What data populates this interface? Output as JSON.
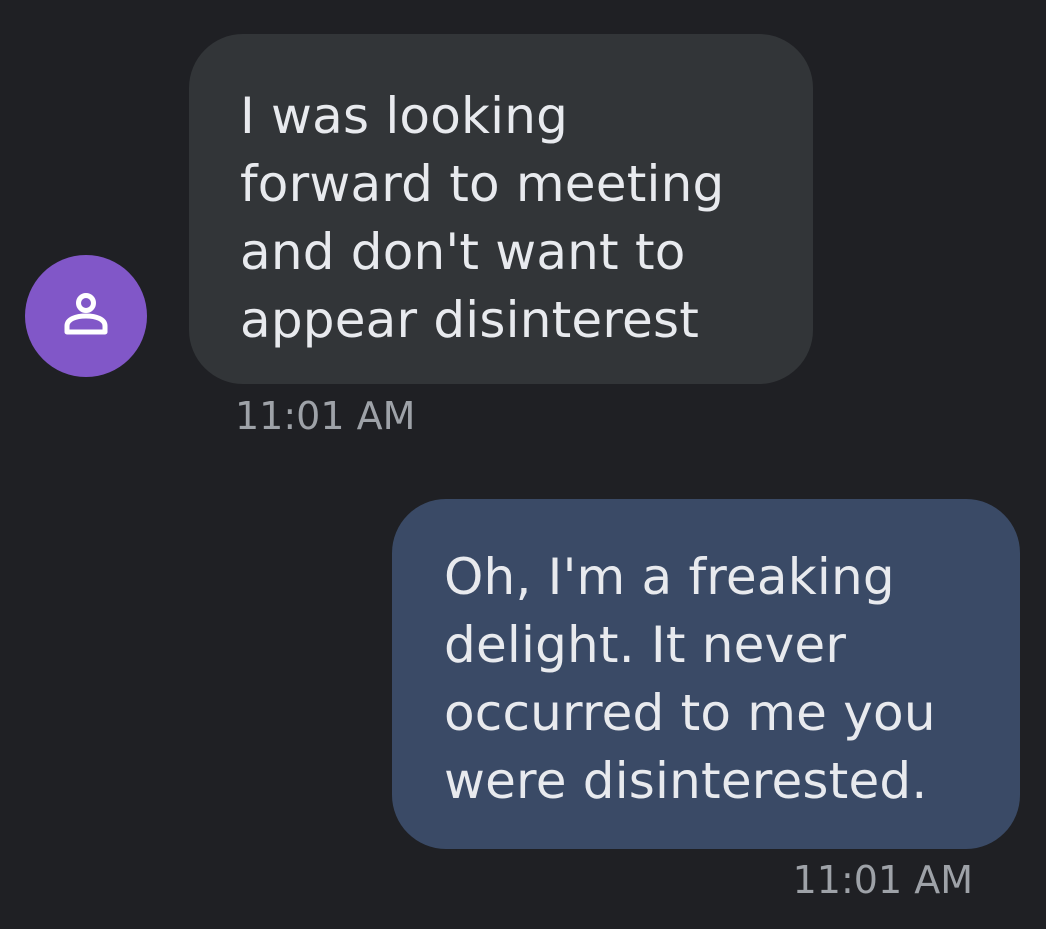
{
  "colors": {
    "background": "#1f2024",
    "incoming_bubble": "#323538",
    "outgoing_bubble": "#3a4a66",
    "message_text": "#e8eaee",
    "timestamp_text": "#9ea2a8",
    "avatar_bg": "#8157c8",
    "avatar_icon": "#ffffff"
  },
  "conversation": {
    "messages": [
      {
        "direction": "incoming",
        "avatar_icon": "person-icon",
        "text": "I was looking\nforward to meeting\nand don't want to\nappear disinterest",
        "time": "11:01 AM"
      },
      {
        "direction": "outgoing",
        "text": "Oh, I'm a freaking\ndelight. It never\noccurred to me you\nwere disinterested.",
        "time": "11:01 AM"
      }
    ]
  }
}
